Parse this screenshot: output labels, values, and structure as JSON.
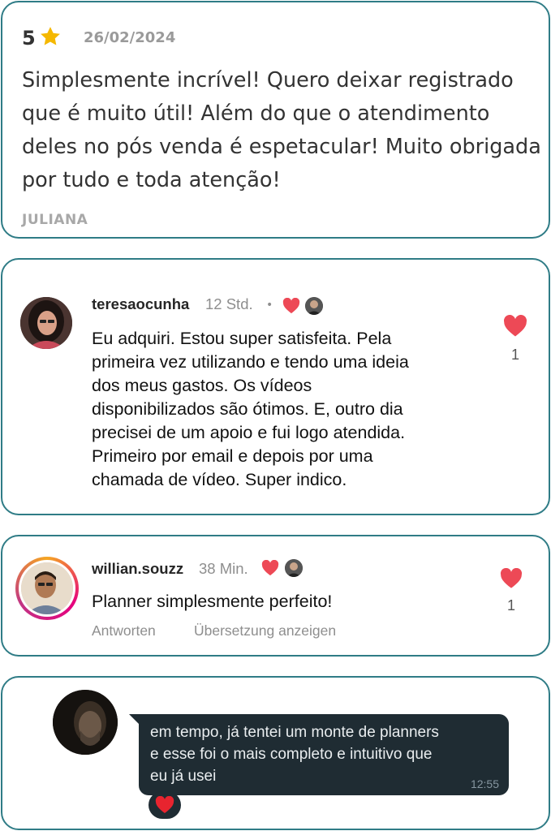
{
  "review": {
    "rating": "5",
    "date": "26/02/2024",
    "lines": [
      "Simplesmente incrível! Quero deixar registrado",
      "que é muito útil! Além do que o atendimento",
      "deles no pós venda é espetacular! Muito obrigada",
      "por tudo e toda atenção!"
    ],
    "author": "JULIANA"
  },
  "comment1": {
    "username": "teresaocunha",
    "time": "12 Std.",
    "separator": "•",
    "lines": [
      "Eu adquiri. Estou super satisfeita. Pela",
      "primeira vez utilizando e tendo uma ideia",
      "dos meus gastos. Os vídeos",
      "disponibilizados são ótimos. E, outro dia",
      "precisei de um apoio e fui logo atendida.",
      "Primeiro por email e depois por uma",
      "chamada de vídeo. Super indico."
    ],
    "likes": "1"
  },
  "comment2": {
    "username": "willian.souzz",
    "time": "38 Min.",
    "text": "Planner simplesmente perfeito!",
    "reply_label": "Antworten",
    "translate_label": "Übersetzung anzeigen",
    "likes": "1"
  },
  "chat": {
    "lines": [
      "em tempo, já tentei um monte de planners",
      "e esse foi o mais completo e intuitivo que",
      "eu já usei"
    ],
    "time": "12:55",
    "reaction": "heart-emoji"
  },
  "colors": {
    "border": "#2f7c86",
    "heart": "#ed4956",
    "star": "#f5b800",
    "bubble": "#1f2c33"
  }
}
